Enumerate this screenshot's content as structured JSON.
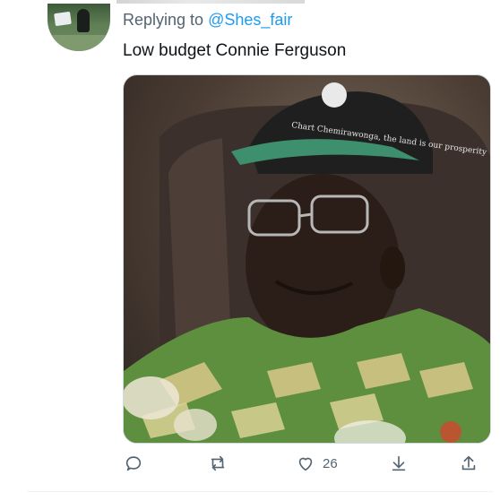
{
  "reply": {
    "prefix": "Replying to",
    "handle": "@Shes_fair"
  },
  "tweet": {
    "text": "Low budget Connie Ferguson"
  },
  "media": {
    "cap_text": "Chart Chemirawonga, the land is our prosperity"
  },
  "actions": {
    "reply_icon": "reply-icon",
    "retweet_icon": "retweet-icon",
    "like_icon": "heart-icon",
    "like_count": "26",
    "share_icon": "share-icon",
    "upload_icon": "upload-icon"
  },
  "colors": {
    "link": "#1d9bf0",
    "secondary_text": "#536471",
    "primary_text": "#0f1419",
    "border": "#cfd9de"
  }
}
